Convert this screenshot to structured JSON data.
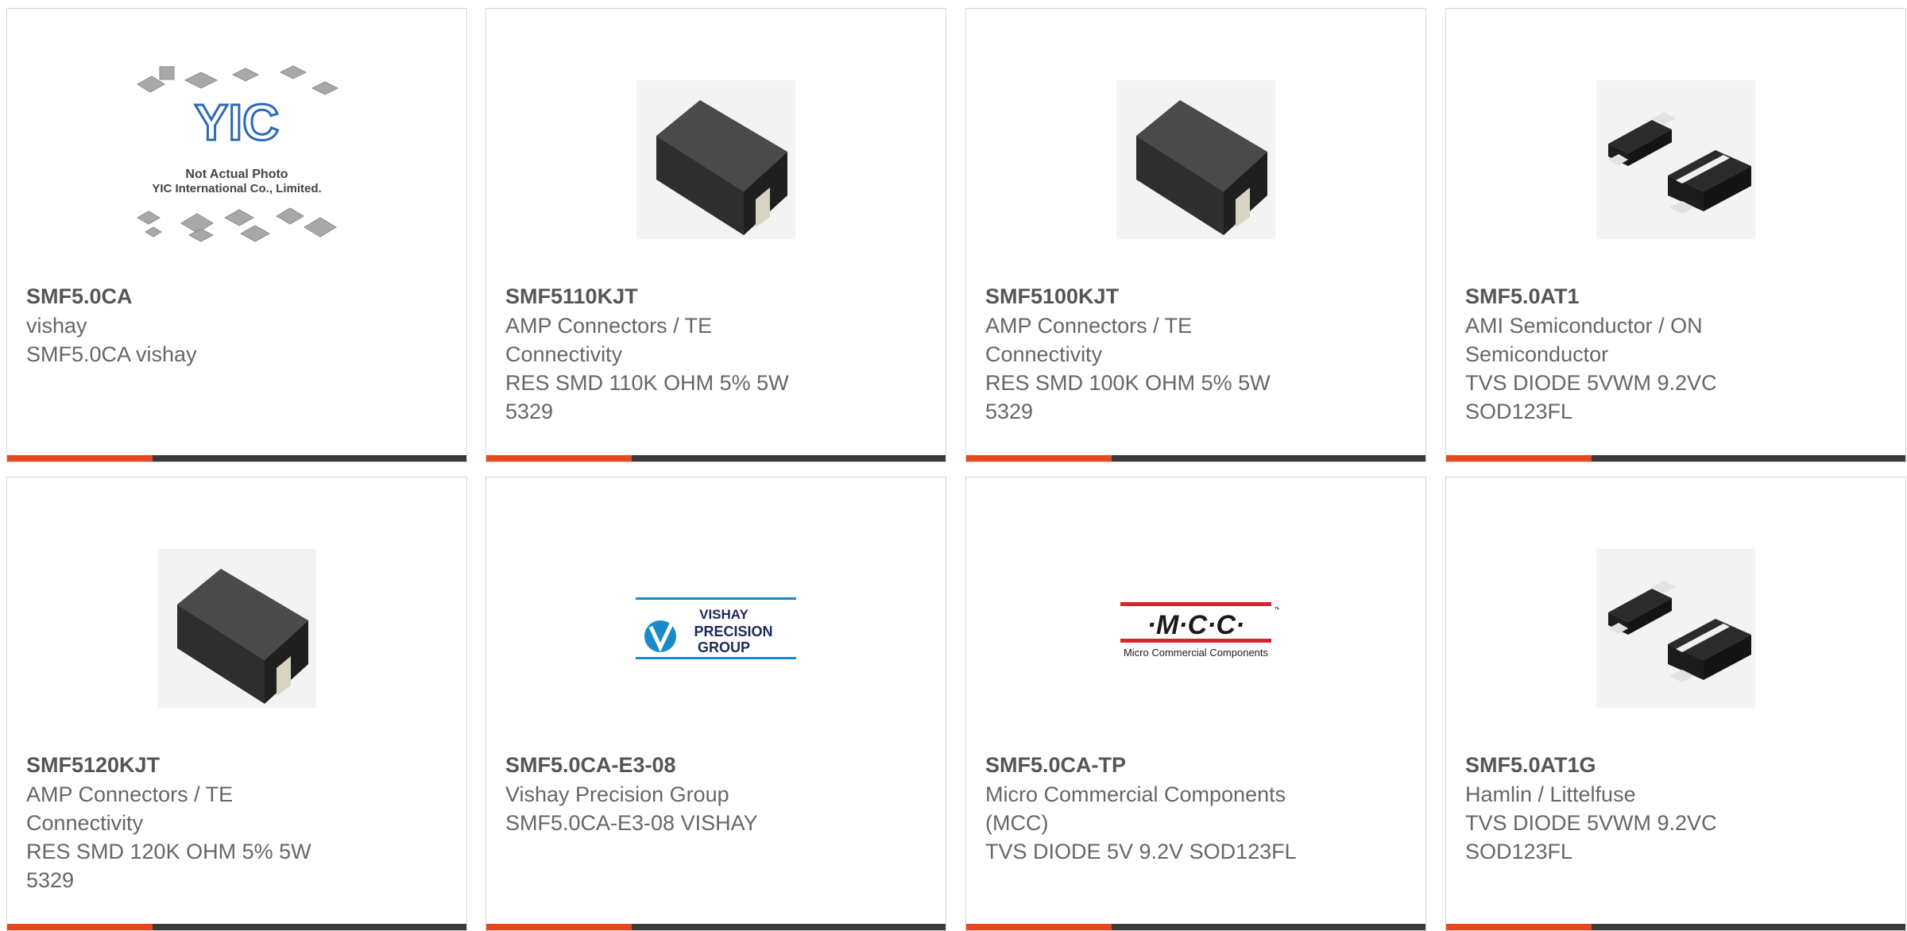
{
  "colors": {
    "accent": "#e8461d",
    "bar": "#3a3a3a",
    "title": "#555555",
    "text": "#666666"
  },
  "products": [
    {
      "part": "SMF5.0CA",
      "lines": [
        "vishay",
        "SMF5.0CA vishay"
      ],
      "image": "yic-not-actual-photo",
      "image_text": {
        "logo": "YIC",
        "caption1": "Not Actual Photo",
        "caption2": "YIC International Co., Limited."
      }
    },
    {
      "part": "SMF5110KJT",
      "lines": [
        "AMP Connectors / TE",
        "Connectivity",
        "RES SMD 110K OHM 5% 5W",
        "5329"
      ],
      "image": "smd-resistor-photo"
    },
    {
      "part": "SMF5100KJT",
      "lines": [
        "AMP Connectors / TE",
        "Connectivity",
        "RES SMD 100K OHM 5% 5W",
        "5329"
      ],
      "image": "smd-resistor-photo"
    },
    {
      "part": "SMF5.0AT1",
      "lines": [
        "AMI Semiconductor / ON",
        "Semiconductor",
        "TVS DIODE 5VWM 9.2VC",
        "SOD123FL"
      ],
      "image": "sod123fl-diode-photo"
    },
    {
      "part": "SMF5120KJT",
      "lines": [
        "AMP Connectors / TE",
        "Connectivity",
        "RES SMD 120K OHM 5% 5W",
        "5329"
      ],
      "image": "smd-resistor-photo"
    },
    {
      "part": "SMF5.0CA-E3-08",
      "lines": [
        "Vishay Precision Group",
        "SMF5.0CA-E3-08 VISHAY"
      ],
      "image": "vishay-precision-logo",
      "image_text": {
        "l1": "VISHAY",
        "l2": "PRECISION",
        "l3": "GROUP"
      }
    },
    {
      "part": "SMF5.0CA-TP",
      "lines": [
        "Micro Commercial Components",
        "(MCC)",
        "TVS DIODE 5V 9.2V SOD123FL"
      ],
      "image": "mcc-logo",
      "image_text": {
        "logo": "·M·C·C·",
        "sub": "Micro Commercial Components",
        "tm": "™"
      }
    },
    {
      "part": "SMF5.0AT1G",
      "lines": [
        "Hamlin / Littelfuse",
        "TVS DIODE 5VWM 9.2VC",
        "SOD123FL"
      ],
      "image": "sod123fl-diode-photo"
    }
  ]
}
